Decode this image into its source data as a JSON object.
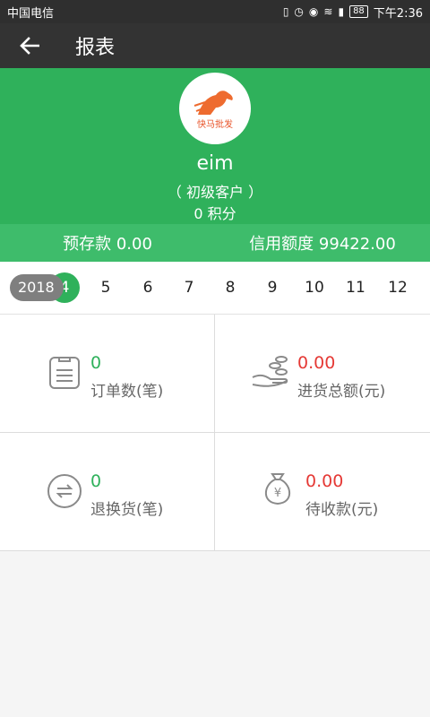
{
  "status_bar": {
    "carrier": "中国电信",
    "battery": "88",
    "time": "下午2:36"
  },
  "toolbar": {
    "title": "报表"
  },
  "profile": {
    "logo_text": "快马批发",
    "name": "eim",
    "level": "（ 初级客户 ）",
    "points": "0 积分"
  },
  "balance": {
    "deposit": "预存款 0.00",
    "credit": "信用额度 99422.00"
  },
  "period": {
    "year": "2018",
    "months": [
      "4",
      "5",
      "6",
      "7",
      "8",
      "9",
      "10",
      "11",
      "12"
    ],
    "selected_month": "4"
  },
  "stats": [
    {
      "value": "0",
      "label": "订单数(笔)",
      "icon": "clipboard-icon",
      "value_color": "#2fb15b"
    },
    {
      "value": "0.00",
      "label": "进货总额(元)",
      "icon": "hand-coins-icon",
      "value_color": "#e53935"
    },
    {
      "value": "0",
      "label": "退换货(笔)",
      "icon": "exchange-icon",
      "value_color": "#2fb15b"
    },
    {
      "value": "0.00",
      "label": "待收款(元)",
      "icon": "money-bag-icon",
      "value_color": "#e53935"
    }
  ],
  "colors": {
    "accent": "#2fb15b",
    "toolbar": "#333333",
    "negative": "#e53935"
  }
}
